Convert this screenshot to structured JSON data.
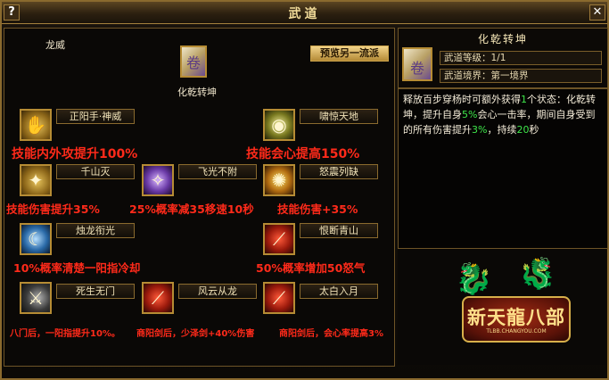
{
  "window": {
    "title": "武道",
    "help_label": "?",
    "close_label": "✕"
  },
  "left": {
    "faction_label": "龙威",
    "main_skill_name": "化乾转坤",
    "preview_button": "预览另一流派",
    "skills": [
      {
        "name": "正阳手·神威",
        "effect": "技能内外攻提升100%"
      },
      {
        "name": "啸惊天地",
        "effect": "技能会心提高150%"
      },
      {
        "name": "千山灭",
        "effect": "技能伤害提升35%"
      },
      {
        "name": "飞光不附",
        "effect": "25%概率减35移速10秒"
      },
      {
        "name": "怒震列缺",
        "effect": "技能伤害+35%"
      },
      {
        "name": "烛龙衔光",
        "effect": "10%概率清楚一阳指冷却"
      },
      {
        "name": "恨断青山",
        "effect": "50%概率增加50怒气"
      },
      {
        "name": "死生无门",
        "effect": "八门后，一阳指提升10%。"
      },
      {
        "name": "风云从龙",
        "effect": "商阳剑后，少泽剑+40%伤害"
      },
      {
        "name": "太白入月",
        "effect": "商阳剑后，会心率提高3%"
      }
    ]
  },
  "right": {
    "title": "化乾转坤",
    "level_label": "武道等级：1/1",
    "realm_label": "武道境界：第一境界",
    "desc": {
      "p1": "释放百步穿杨时可额外获得",
      "n1": "1",
      "p2": "个状态：化乾转坤，提升自身",
      "n2": "5%",
      "p3": "会心一击率，期间自身受到的所有伤害提升",
      "n3": "3%",
      "p4": "，持续",
      "n4": "20",
      "p5": "秒"
    }
  },
  "logo": {
    "text": "新天龍八部",
    "sub": "TLBB.CHANGYOU.COM"
  },
  "colors": {
    "effect_red": "#ff2a1a",
    "highlight_green": "#3ee64a",
    "frame_gold": "#8a6a2e"
  }
}
